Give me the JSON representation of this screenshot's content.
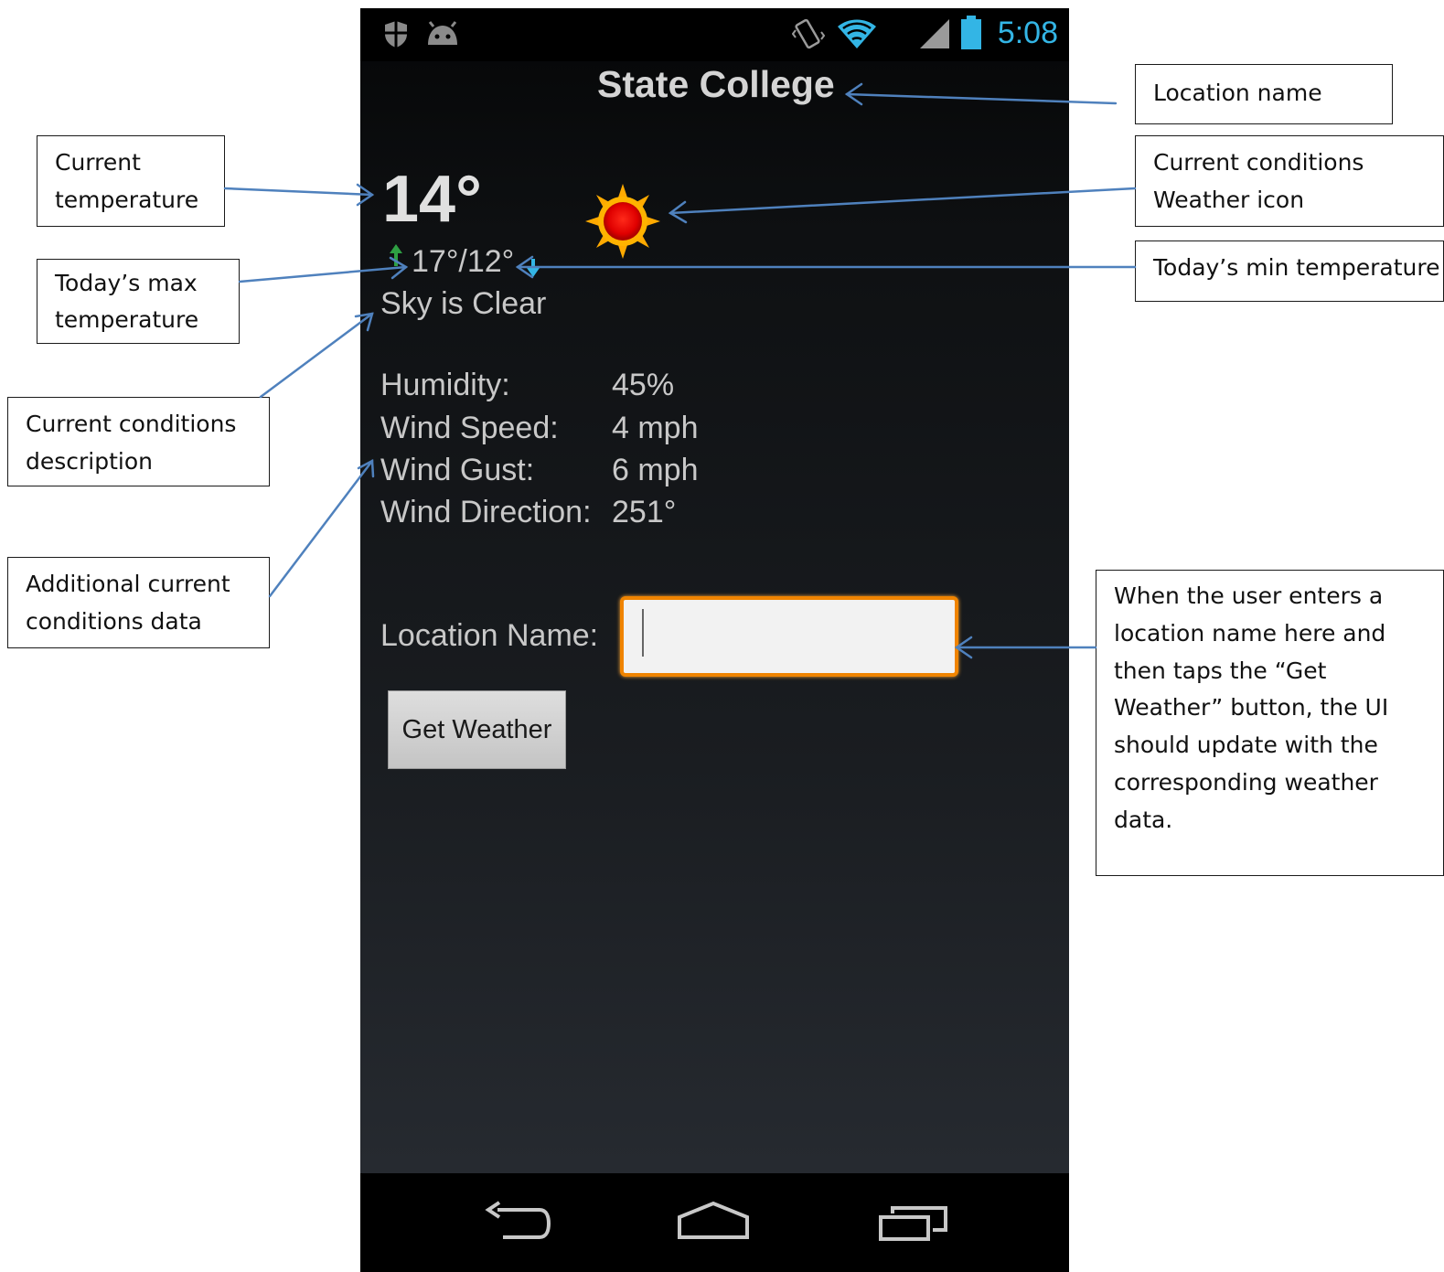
{
  "status_bar": {
    "time": "5:08",
    "left_icons": [
      "shield-icon",
      "android-icon"
    ],
    "right_icons": [
      "vibrate-icon",
      "wifi-icon",
      "signal-icon",
      "battery-icon"
    ]
  },
  "app": {
    "location_title": "State College",
    "current_temp": "14°",
    "max_min_temp": "17°/12°",
    "weather_icon": "sun-icon",
    "description": "Sky is Clear",
    "details": [
      {
        "label": "Humidity:",
        "value": "45%"
      },
      {
        "label": "Wind Speed:",
        "value": "4 mph"
      },
      {
        "label": "Wind Gust:",
        "value": "6 mph"
      },
      {
        "label": "Wind Direction:",
        "value": "251°"
      }
    ],
    "location_input_label": "Location Name:",
    "location_input_value": "",
    "button_label": "Get Weather"
  },
  "nav_bar": {
    "icons": [
      "back-icon",
      "home-icon",
      "recent-apps-icon"
    ]
  },
  "annotations": {
    "current_temperature": [
      "Current",
      "temperature"
    ],
    "max_temperature": [
      "Today’s max",
      "temperature"
    ],
    "conditions_description": [
      "Current conditions",
      "description"
    ],
    "additional_data": [
      "Additional current",
      "conditions data"
    ],
    "location_name": [
      "Location name"
    ],
    "weather_icon": [
      "Current conditions",
      "Weather icon"
    ],
    "min_temperature": [
      "Today’s min temperature"
    ],
    "input_note": [
      "When the user enters a",
      "location name here and",
      "then taps the “Get",
      "Weather” button, the UI",
      "should update with the",
      "corresponding weather",
      "data."
    ]
  },
  "colors": {
    "accent_clock": "#33b5e5",
    "input_border": "#f08400",
    "arrow": "#4f81bd",
    "up_arrow": "#2ea043"
  }
}
